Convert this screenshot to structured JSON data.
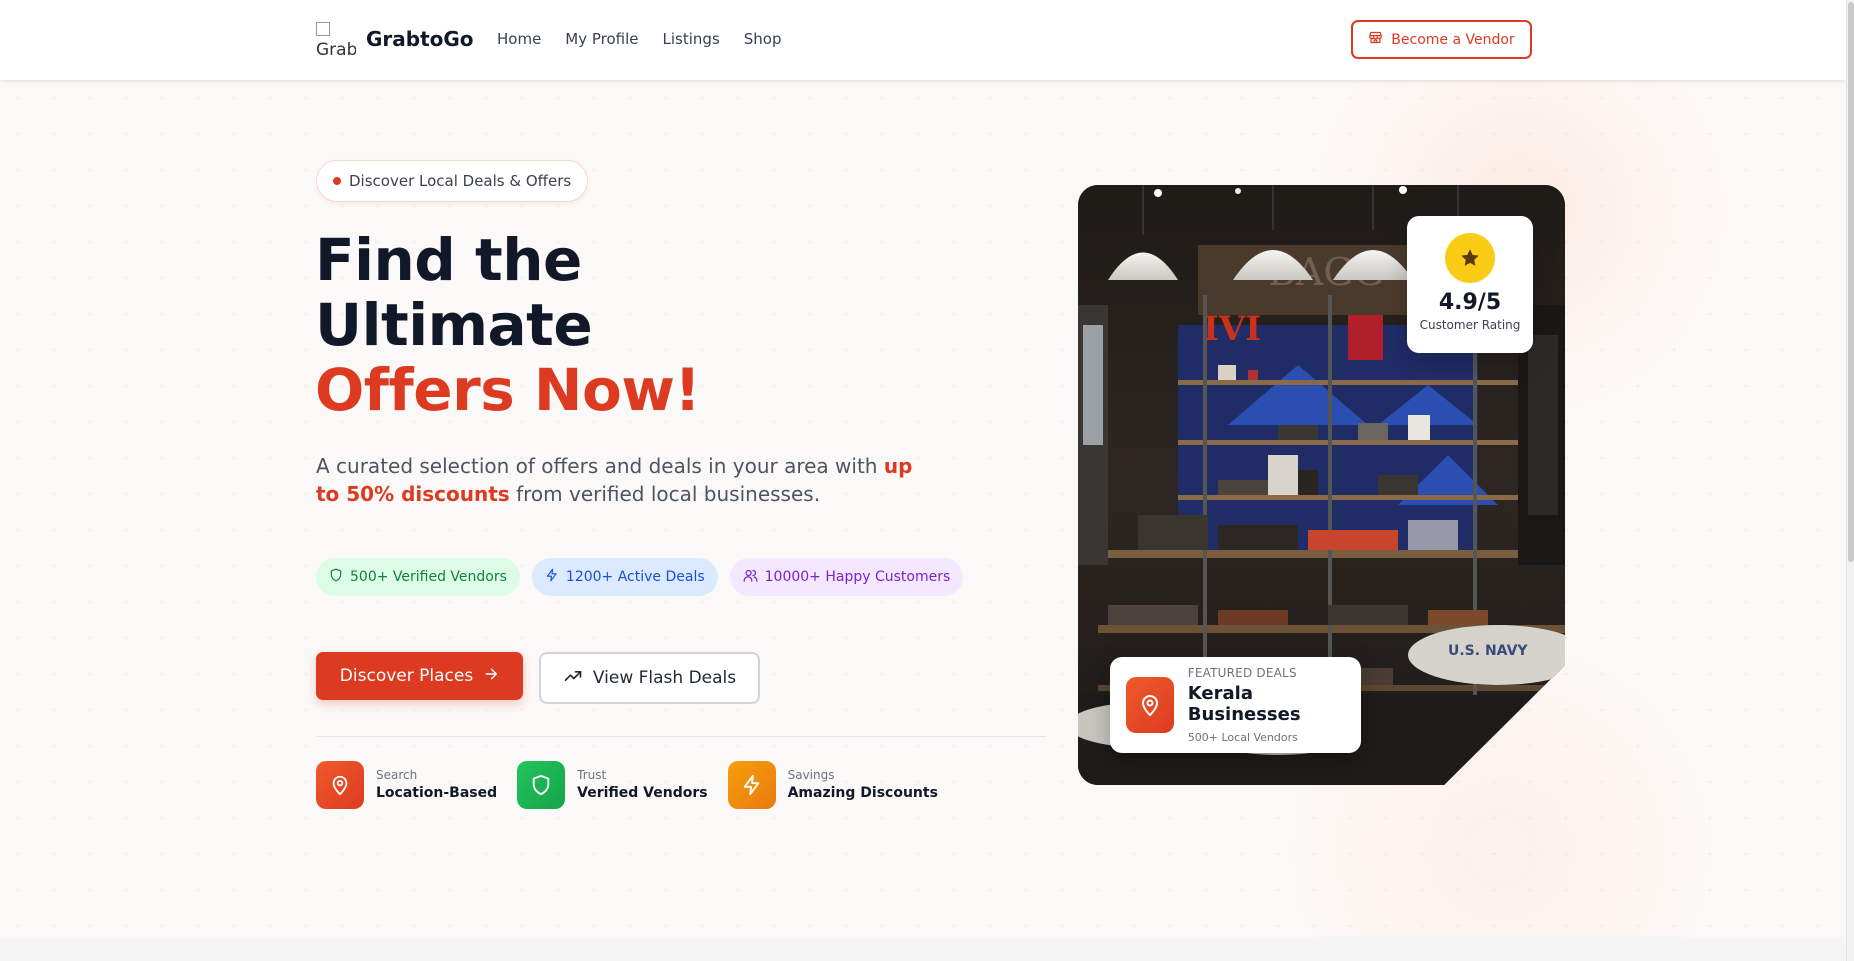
{
  "brand": {
    "logo_alt": "Grabt",
    "name": "GrabtoGo"
  },
  "nav": {
    "items": [
      "Home",
      "My Profile",
      "Listings",
      "Shop"
    ]
  },
  "header": {
    "vendor_button": "Become a Vendor",
    "vendor_icon": "store-icon"
  },
  "hero": {
    "pill": "Discover Local Deals & Offers",
    "headline_line1": "Find the",
    "headline_line2": "Ultimate",
    "headline_accent": "Offers Now!",
    "subtext_pre": "A curated selection of offers and deals in your area with ",
    "subtext_highlight": "up to 50% discounts",
    "subtext_post": " from verified local businesses.",
    "stats": [
      {
        "label": "500+ Verified Vendors",
        "icon": "shield-icon",
        "color": "#15803d"
      },
      {
        "label": "1200+ Active Deals",
        "icon": "lightning-icon",
        "color": "#1d4ed8"
      },
      {
        "label": "10000+ Happy Customers",
        "icon": "users-icon",
        "color": "#7e22ce"
      }
    ],
    "primary_button": "Discover Places",
    "secondary_button": "View Flash Deals",
    "features": [
      {
        "small": "Search",
        "big": "Location-Based",
        "icon": "map-pin-icon"
      },
      {
        "small": "Trust",
        "big": "Verified Vendors",
        "icon": "shield-icon"
      },
      {
        "small": "Savings",
        "big": "Amazing Discounts",
        "icon": "lightning-icon"
      }
    ]
  },
  "rating_card": {
    "value": "4.9/5",
    "label": "Customer Rating",
    "icon": "star-icon"
  },
  "featured_card": {
    "small": "Featured Deals",
    "title": "Kerala Businesses",
    "sub": "500+ Local Vendors",
    "icon": "map-pin-icon"
  },
  "colors": {
    "accent": "#dc3b21",
    "text_dark": "#111827",
    "star": "#facc15"
  }
}
